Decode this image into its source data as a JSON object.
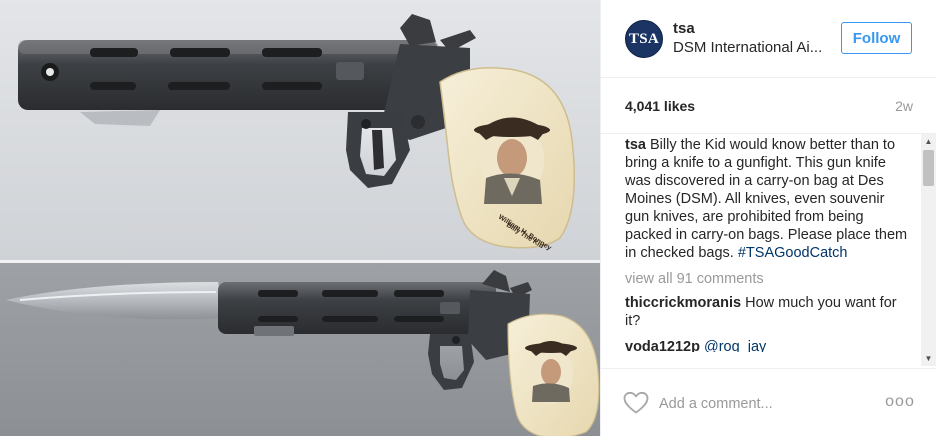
{
  "post": {
    "image_alt": "Gun knife shown closed (top) and with blade open (bottom)",
    "grip_inscription": [
      "William H. Bonney",
      "Billy The Kid"
    ]
  },
  "header": {
    "avatar_text": "TSA",
    "username": "tsa",
    "location": "DSM International Ai...",
    "follow_label": "Follow"
  },
  "stats": {
    "likes": "4,041 likes",
    "time_ago": "2w"
  },
  "caption": {
    "username": "tsa",
    "text": " Billy the Kid would know better than to bring a knife to a gunfight. This gun knife was discovered in a carry-on bag at Des Moines (DSM). All knives, even souvenir gun knives, are prohibited from being packed in carry-on bags. Please place them in checked bags. ",
    "hashtag": "#TSAGoodCatch"
  },
  "view_all": "view all 91 comments",
  "comments": [
    {
      "username": "thiccrickmoranis",
      "text": " How much you want for it?"
    },
    {
      "username": "voda1212p",
      "mention": "@rog_jay"
    }
  ],
  "add_comment": {
    "placeholder": "Add a comment..."
  },
  "more_glyph": "ooo",
  "colors": {
    "accent": "#3897f0",
    "link": "#003569",
    "muted": "#999999",
    "brand": "#1c3464"
  },
  "icons": [
    "heart-icon",
    "more-options-icon",
    "scroll-up-arrow",
    "scroll-down-arrow"
  ]
}
